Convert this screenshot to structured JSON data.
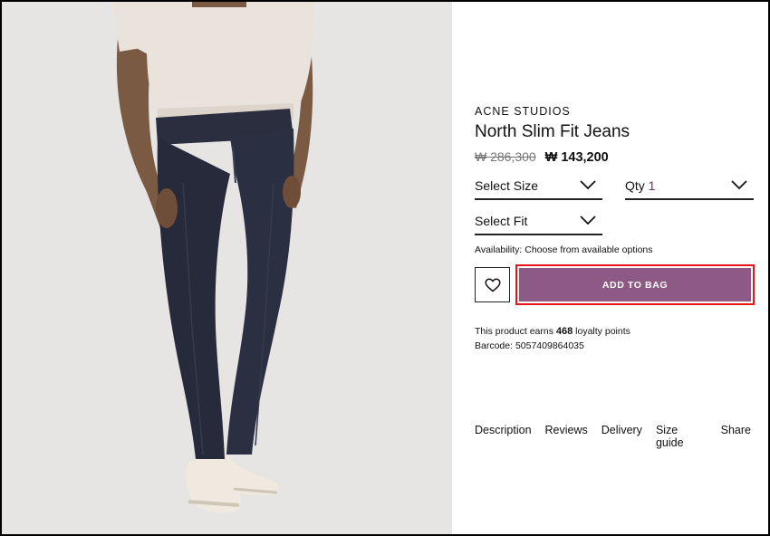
{
  "product": {
    "brand": "ACNE STUDIOS",
    "title": "North Slim Fit Jeans",
    "price_original": "₩ 286,300",
    "price_sale": "₩ 143,200"
  },
  "options": {
    "size_label": "Select Size",
    "qty_label": "Qty",
    "qty_value": "1",
    "fit_label": "Select Fit"
  },
  "availability": "Availability: Choose from available options",
  "actions": {
    "wishlist_icon": "heart-icon",
    "add_to_bag": "ADD TO BAG"
  },
  "loyalty": {
    "prefix": "This product earns",
    "points": "468",
    "suffix": "loyalty points"
  },
  "barcode": "Barcode: 5057409864035",
  "tabs": [
    {
      "label": "Description"
    },
    {
      "label": "Reviews"
    },
    {
      "label": "Delivery"
    },
    {
      "label": "Size guide"
    },
    {
      "label": "Share"
    }
  ],
  "colors": {
    "accent": "#8c5a85",
    "highlight_border": "#e8141c",
    "image_bg": "#e6e5e3",
    "denim": "#262a3a"
  }
}
